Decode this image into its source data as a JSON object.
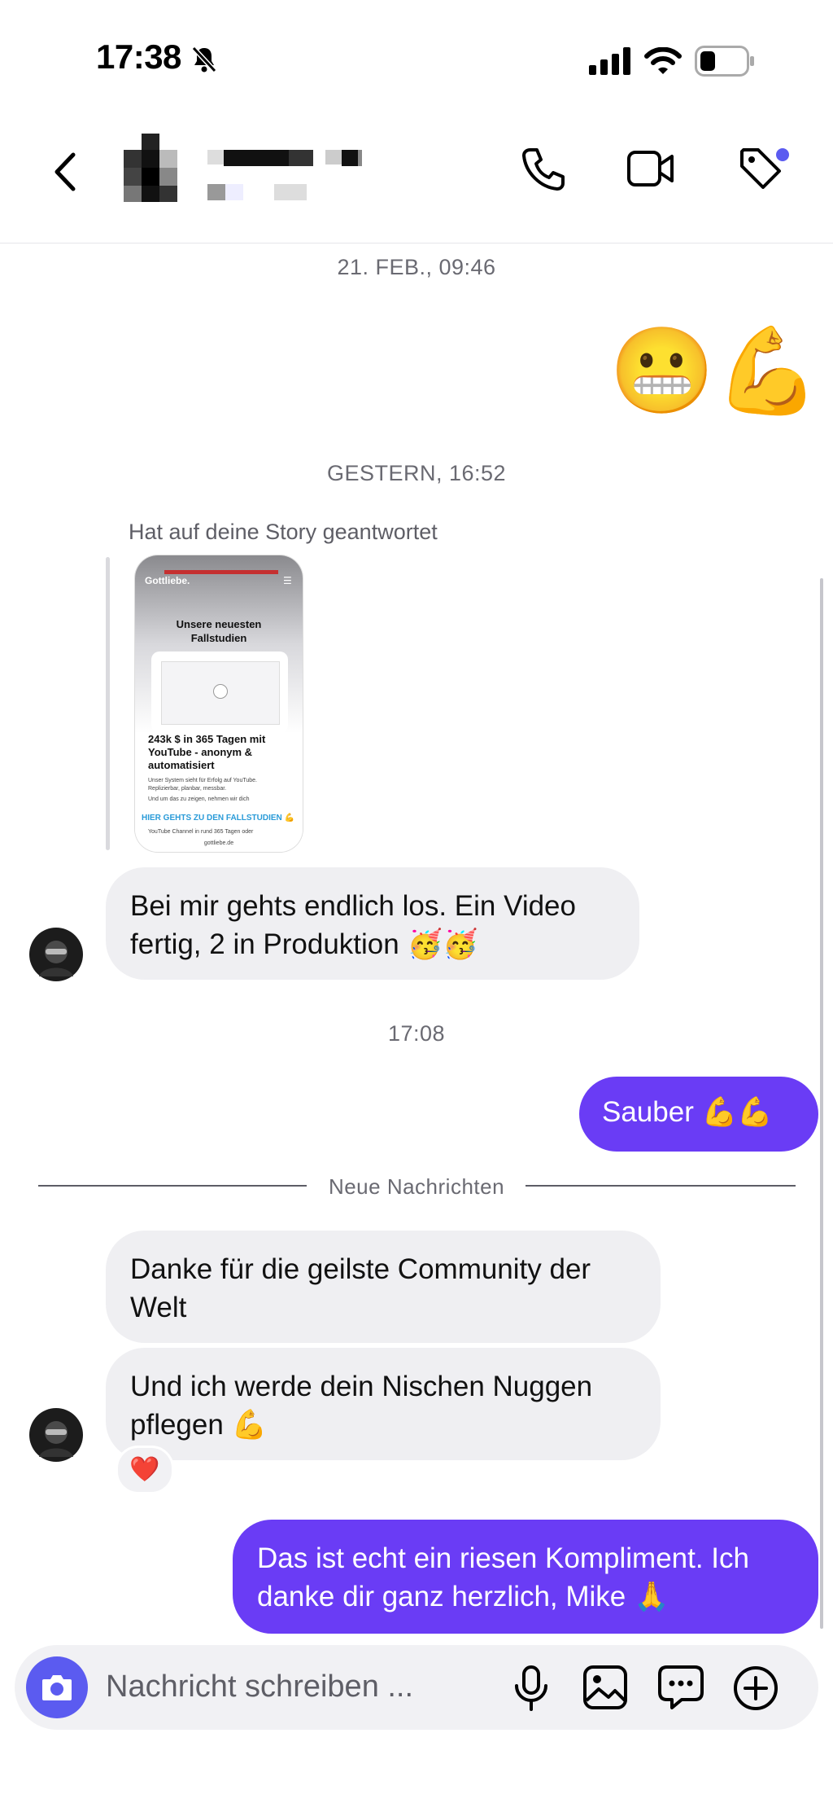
{
  "status": {
    "time": "17:38"
  },
  "header": {
    "contact_name": "",
    "contact_sub": ""
  },
  "conversation": {
    "timestamp_1": "21. FEB., 09:46",
    "emoji_message": "😬💪",
    "timestamp_2": "GESTERN, 16:52",
    "story_reply_label": "Hat auf deine Story geantwortet",
    "story": {
      "brand": "Gottliebe.",
      "title": "Unsere neuesten Fallstudien",
      "headline": "243k $ in 365 Tagen mit YouTube - anonym & automatisiert",
      "body1": "Unser System sieht für Erfolg auf YouTube. Replizierbar, planbar, messbar.",
      "body2": "Und um das zu zeigen, nehmen wir dich",
      "cta": "HIER GEHTS ZU DEN FALLSTUDIEN 💪",
      "footer_line": "YouTube Channel in rund 365 Tagen oder",
      "domain": "gottliebe.de"
    },
    "msg_in_1": "Bei mir gehts endlich los. Ein Video fertig, 2 in Produktion 🥳🥳",
    "timestamp_3": "17:08",
    "msg_out_1": "Sauber 💪💪",
    "new_messages_label": "Neue Nachrichten",
    "msg_in_2": "Danke für die geilste Community der Welt",
    "msg_in_3": "Und ich werde dein Nischen Nuggen pflegen 💪",
    "reaction": "❤️",
    "msg_out_2": "Das ist echt ein riesen Kompliment. Ich danke dir ganz herzlich, Mike 🙏"
  },
  "composer": {
    "placeholder": "Nachricht schreiben ..."
  },
  "colors": {
    "accent": "#6a3cf5",
    "composer_camera": "#5b5bf0",
    "bubble_in": "#efeff2",
    "tag_dot": "#5b5bf0"
  },
  "icons": [
    "bell-slash-icon",
    "signal-icon",
    "wifi-icon",
    "battery-icon",
    "back-chevron-icon",
    "phone-icon",
    "video-camera-icon",
    "tag-icon",
    "camera-icon",
    "microphone-icon",
    "image-icon",
    "sticker-icon",
    "plus-circle-icon"
  ]
}
